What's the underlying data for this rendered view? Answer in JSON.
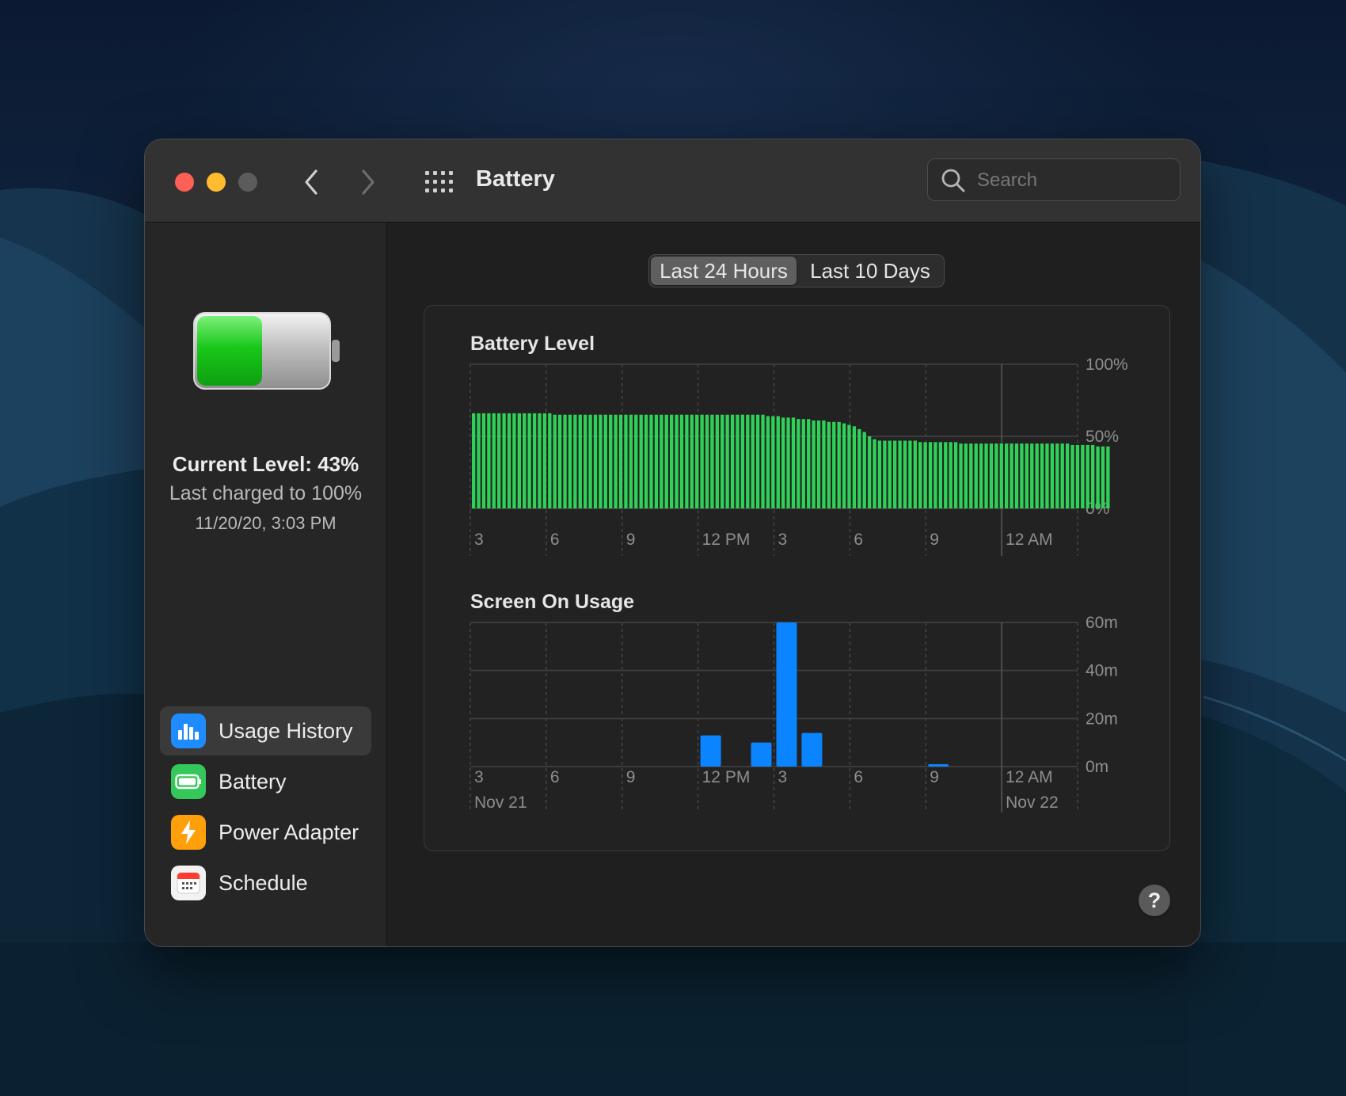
{
  "window": {
    "title": "Battery"
  },
  "toolbar": {
    "back_icon": "chevron-left-icon",
    "forward_icon": "chevron-right-icon",
    "grid_icon": "show-all-grid-icon",
    "search_placeholder": "Search"
  },
  "status": {
    "current_level": "Current Level: 43%",
    "last_charged": "Last charged to 100%",
    "charged_time": "11/20/20, 3:03 PM",
    "battery_fill_fraction": 0.5
  },
  "sidebar": {
    "items": [
      {
        "label": "Usage History",
        "icon": "usage-history-icon",
        "color": "#1e8cff",
        "active": true
      },
      {
        "label": "Battery",
        "icon": "battery-icon",
        "color": "#34c759",
        "active": false
      },
      {
        "label": "Power Adapter",
        "icon": "power-adapter-icon",
        "color": "#ff9f0a",
        "active": false
      },
      {
        "label": "Schedule",
        "icon": "schedule-icon",
        "color": "#ffffff",
        "active": false
      }
    ]
  },
  "segmented": {
    "options": [
      "Last 24 Hours",
      "Last 10 Days"
    ],
    "selected": 0
  },
  "help": {
    "label": "?"
  },
  "chart_data": [
    {
      "type": "bar",
      "title": "Battery Level",
      "x_tick_labels": [
        "3",
        "6",
        "9",
        "12 PM",
        "3",
        "6",
        "9",
        "12 AM"
      ],
      "y_tick_labels": [
        "100%",
        "50%",
        "0%"
      ],
      "ylim": [
        0,
        100
      ],
      "color": "#30d158",
      "values": [
        66,
        66,
        66,
        66,
        66,
        66,
        66,
        66,
        66,
        66,
        66,
        66,
        66,
        66,
        66,
        66,
        65,
        65,
        65,
        65,
        65,
        65,
        65,
        65,
        65,
        65,
        65,
        65,
        65,
        65,
        65,
        65,
        65,
        65,
        65,
        65,
        65,
        65,
        65,
        65,
        65,
        65,
        65,
        65,
        65,
        65,
        65,
        65,
        65,
        65,
        65,
        65,
        65,
        65,
        65,
        65,
        65,
        65,
        64,
        64,
        64,
        63,
        63,
        63,
        62,
        62,
        62,
        61,
        61,
        61,
        60,
        60,
        60,
        59,
        58,
        57,
        55,
        53,
        50,
        48,
        47,
        47,
        47,
        47,
        47,
        47,
        47,
        47,
        46,
        46,
        46,
        46,
        46,
        46,
        46,
        46,
        45,
        45,
        45,
        45,
        45,
        45,
        45,
        45,
        45,
        45,
        45,
        45,
        45,
        45,
        45,
        45,
        45,
        45,
        45,
        45,
        45,
        45,
        44,
        44,
        44,
        44,
        44,
        43,
        43,
        43
      ]
    },
    {
      "type": "bar",
      "title": "Screen On Usage",
      "x_tick_labels": [
        "3",
        "6",
        "9",
        "12 PM",
        "3",
        "6",
        "9",
        "12 AM"
      ],
      "date_labels": [
        "Nov 21",
        "Nov 22"
      ],
      "y_tick_labels": [
        "60m",
        "40m",
        "20m",
        "0m"
      ],
      "ylim": [
        0,
        60
      ],
      "color": "#0a84ff",
      "values": [
        0,
        0,
        0,
        0,
        0,
        0,
        0,
        0,
        0,
        13,
        0,
        10,
        60,
        14,
        0,
        0,
        0,
        0,
        1,
        0,
        0,
        0,
        0,
        0
      ]
    }
  ]
}
